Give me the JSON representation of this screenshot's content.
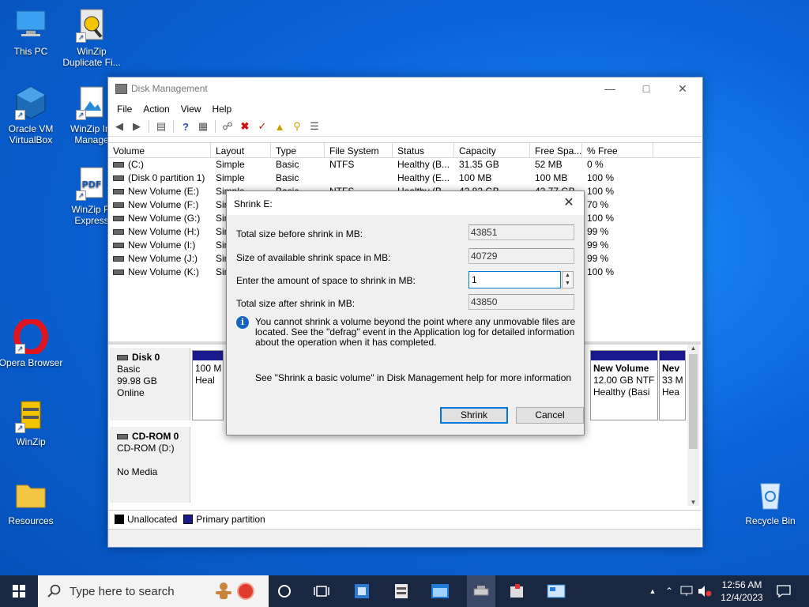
{
  "desktop": {
    "icons": [
      {
        "label": "This PC"
      },
      {
        "label": "WinZip Duplicate Fi..."
      },
      {
        "label": "Oracle VM VirtualBox"
      },
      {
        "label": "WinZip Im Manage"
      },
      {
        "label": "WinZip Pl Express"
      },
      {
        "label": "Opera Browser"
      },
      {
        "label": "WinZip"
      },
      {
        "label": "Resources"
      },
      {
        "label": "Recycle Bin"
      }
    ]
  },
  "window": {
    "title": "Disk Management",
    "menu": [
      "File",
      "Action",
      "View",
      "Help"
    ],
    "columns": [
      "Volume",
      "Layout",
      "Type",
      "File System",
      "Status",
      "Capacity",
      "Free Spa...",
      "% Free"
    ],
    "rows": [
      {
        "volume": "(C:)",
        "layout": "Simple",
        "type": "Basic",
        "fs": "NTFS",
        "status": "Healthy (B...",
        "capacity": "31.35 GB",
        "free": "52 MB",
        "pct": "0 %"
      },
      {
        "volume": "(Disk 0 partition 1)",
        "layout": "Simple",
        "type": "Basic",
        "fs": "",
        "status": "Healthy (E...",
        "capacity": "100 MB",
        "free": "100 MB",
        "pct": "100 %"
      },
      {
        "volume": "New Volume (E:)",
        "layout": "Simple",
        "type": "Basic",
        "fs": "NTFS",
        "status": "Healthy (B...",
        "capacity": "42.82 GB",
        "free": "42.77 GB",
        "pct": "100 %"
      },
      {
        "volume": "New Volume (F:)",
        "layout": "Sir",
        "type": "",
        "fs": "",
        "status": "",
        "capacity": "",
        "free": "",
        "pct": "70 %"
      },
      {
        "volume": "New Volume (G:)",
        "layout": "Sir",
        "type": "",
        "fs": "",
        "status": "",
        "capacity": "",
        "free": "",
        "pct": "100 %"
      },
      {
        "volume": "New Volume (H:)",
        "layout": "Sir",
        "type": "",
        "fs": "",
        "status": "",
        "capacity": "",
        "free": "",
        "pct": "99 %"
      },
      {
        "volume": "New Volume (I:)",
        "layout": "Sir",
        "type": "",
        "fs": "",
        "status": "",
        "capacity": "",
        "free": "",
        "pct": "99 %"
      },
      {
        "volume": "New Volume (J:)",
        "layout": "Sir",
        "type": "",
        "fs": "",
        "status": "",
        "capacity": "",
        "free": "",
        "pct": "99 %"
      },
      {
        "volume": "New Volume (K:)",
        "layout": "Sir",
        "type": "",
        "fs": "",
        "status": "",
        "capacity": "",
        "free": "",
        "pct": "100 %"
      }
    ],
    "disk0": {
      "name": "Disk 0",
      "type": "Basic",
      "size": "99.98 GB",
      "state": "Online"
    },
    "cdrom": {
      "name": "CD-ROM 0",
      "type": "CD-ROM (D:)",
      "state": "No Media"
    },
    "partitions": {
      "p1": {
        "line1": "100 M",
        "line2": "Heal"
      },
      "p2": {
        "line1": "New Volume",
        "line2": "12.00 GB NTF",
        "line3": "Healthy (Basi"
      },
      "p3": {
        "line1": "Nev",
        "line2": "33 M",
        "line3": "Hea"
      }
    },
    "legend": {
      "unallocated": "Unallocated",
      "primary": "Primary partition"
    }
  },
  "dialog": {
    "title": "Shrink E:",
    "total_before_label": "Total size before shrink in MB:",
    "total_before": "43851",
    "available_label": "Size of available shrink space in MB:",
    "available": "40729",
    "amount_label": "Enter the amount of space to shrink in MB:",
    "amount": "1",
    "total_after_label": "Total size after shrink in MB:",
    "total_after": "43850",
    "info": "You cannot shrink a volume beyond the point where any unmovable files are located. See the \"defrag\" event in the Application log for detailed information about the operation when it has completed.",
    "help": "See \"Shrink a basic volume\" in Disk Management help for more information",
    "shrink_label": "Shrink",
    "cancel_label": "Cancel"
  },
  "taskbar": {
    "search_placeholder": "Type here to search",
    "time": "12:56 AM",
    "date": "12/4/2023"
  }
}
